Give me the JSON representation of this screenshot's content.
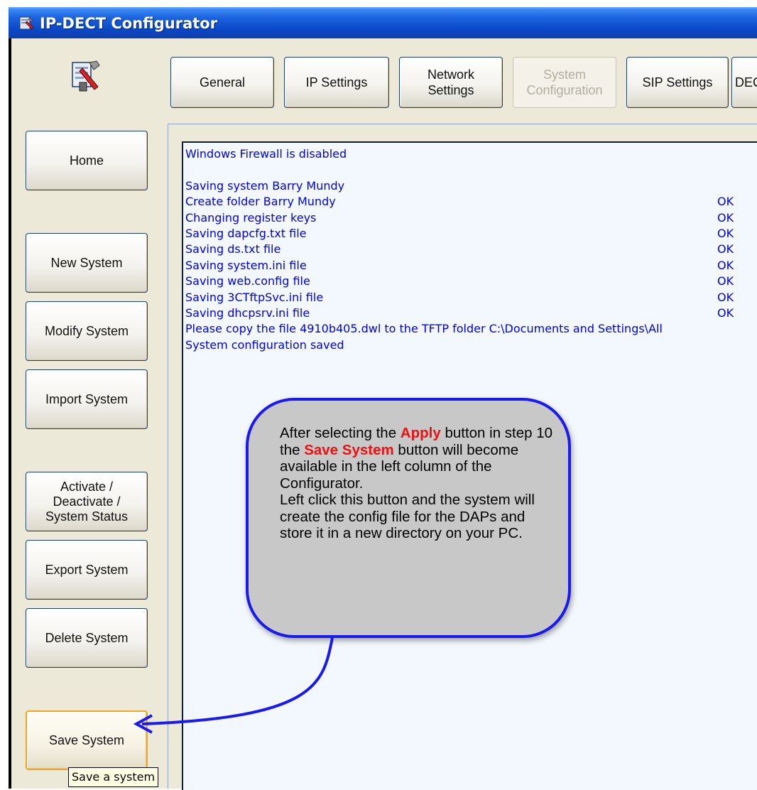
{
  "window": {
    "title": "IP-DECT Configurator"
  },
  "tabs": [
    {
      "label": "General",
      "enabled": true
    },
    {
      "label": "IP Settings",
      "enabled": true
    },
    {
      "label": "Network\nSettings",
      "enabled": true
    },
    {
      "label": "System\nConfiguration",
      "enabled": false
    },
    {
      "label": "SIP Settings",
      "enabled": true
    },
    {
      "label": "DEC",
      "enabled": true
    }
  ],
  "sidebar": {
    "home": "Home",
    "new_system": "New System",
    "modify_system": "Modify System",
    "import_system": "Import System",
    "activate": "Activate /\nDeactivate /\nSystem Status",
    "export_system": "Export System",
    "delete_system": "Delete System",
    "save_system": "Save System"
  },
  "log": {
    "lines": [
      {
        "text": "Windows Firewall is disabled",
        "status": ""
      },
      {
        "text": "",
        "status": ""
      },
      {
        "text": "Saving system Barry Mundy",
        "status": ""
      },
      {
        "text": "Create folder Barry Mundy",
        "status": "OK"
      },
      {
        "text": "Changing register keys",
        "status": "OK"
      },
      {
        "text": "Saving dapcfg.txt file",
        "status": "OK"
      },
      {
        "text": "Saving ds.txt file",
        "status": "OK"
      },
      {
        "text": "Saving system.ini file",
        "status": "OK"
      },
      {
        "text": "Saving web.config file",
        "status": "OK"
      },
      {
        "text": "Saving 3CTftpSvc.ini file",
        "status": "OK"
      },
      {
        "text": "Saving dhcpsrv.ini file",
        "status": "OK"
      },
      {
        "text": "Please copy the file 4910b405.dwl to the TFTP folder C:\\Documents and Settings\\All",
        "status": ""
      },
      {
        "text": "System configuration saved",
        "status": ""
      }
    ]
  },
  "callout": {
    "p1": "After selecting the ",
    "apply": "Apply",
    "p2": " button in step 10 the ",
    "save_system": "Save System",
    "p3": " button will become available in the left column of the Configurator.",
    "p4": "Left click this button and the system will create the config file for the DAPs and store it in a new directory on your PC."
  },
  "tooltip": {
    "text": "Save a system"
  },
  "colors": {
    "title_bar": "#0a48c8",
    "log_text": "#0000ee",
    "callout_border": "#1a1aee",
    "callout_fill": "#c8c8c8",
    "highlight": "#ee1111",
    "hot_border": "#f4a51c"
  },
  "icons": {
    "title_icon": "configurator-tools-icon",
    "app_icon": "configurator-tools-icon"
  }
}
